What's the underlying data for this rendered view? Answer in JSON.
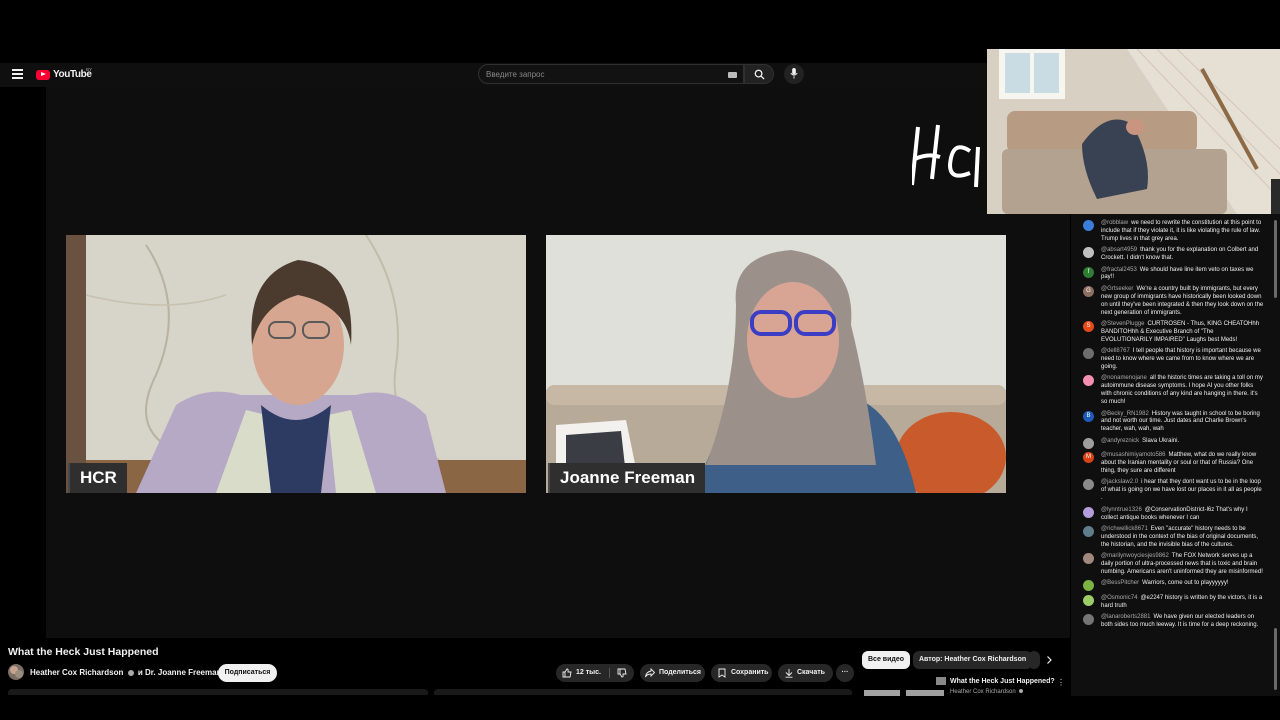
{
  "header": {
    "logo_text": "YouTube",
    "logo_country": "BY",
    "search_placeholder": "Введите запрос"
  },
  "player": {
    "logo_text": "HCR",
    "speakers": [
      {
        "name": "HCR"
      },
      {
        "name": "Joanne Freeman"
      }
    ]
  },
  "chat": {
    "messages": [
      {
        "author": "@robblaw",
        "text": "we need to rewrite the constitution at this point to include that if they violate it, it is like violating the rule of law. Trump lives in that grey area.",
        "color": "#3b7dd8",
        "initial": ""
      },
      {
        "author": "@absart4959",
        "text": "thank you for the explanation on Colbert and Crockett. I didn't know that.",
        "color": "#c0c0c0",
        "initial": ""
      },
      {
        "author": "@fractal2453",
        "text": "We should have line item veto on taxes we pay!!",
        "color": "#2e7d32",
        "initial": "f"
      },
      {
        "author": "@Grtseeker",
        "text": "We're a country built by immigrants, but every new group of immigrants have historically been looked down on until they've been integrated & then they look down on the next generation of immigrants.",
        "color": "#8d6e63",
        "initial": "G"
      },
      {
        "author": "@StevenPlugge",
        "text": "CURTROSEN - Thus, KING CHEATOHhh BANDITOHhh & Executive Branch of \"The EVOLUTIONARILY IMPAIRED\" Laughs best Meds!",
        "color": "#e64a19",
        "initial": "S"
      },
      {
        "author": "@dell8767",
        "text": "I tell people that history is important because we need to know where we came from to know where we are going.",
        "color": "#6d6d6d",
        "initial": ""
      },
      {
        "author": "@nonamenojane",
        "text": "all the historic times are taking a toll on my autoimmune disease symptoms. I hope AI you other folks with chronic conditions of any kind are hanging in there. it's so much!",
        "color": "#f48fb1",
        "initial": ""
      },
      {
        "author": "@Becky_RN1982",
        "text": "History was taught in school to be boring and not worth our time. Just dates and Charlie Brown's teacher, wah, wah, wah",
        "color": "#1e5bb8",
        "initial": "B"
      },
      {
        "author": "@andyreznick",
        "text": "Slava Ukraini.",
        "color": "#9e9e9e",
        "initial": ""
      },
      {
        "author": "@musashimiyamoto586",
        "text": "Matthew, what do we really know about the Iranian mentality or soul or that of Russia? One thing, they sure are different",
        "color": "#d84315",
        "initial": "M"
      },
      {
        "author": "@jackslaw2.0",
        "text": "i hear that they dont want us to be in the loop of what is going on we have lost our places in it all as people .",
        "color": "#8a8a8a",
        "initial": ""
      },
      {
        "author": "@lynntrue1326",
        "text": "@ConservationDistrict-l6z That's why I collect antique books whenever I can",
        "color": "#b39ddb",
        "initial": ""
      },
      {
        "author": "@richwellick8671",
        "text": "Even \"accurate\" history needs to be understood in the context of the bias of original documents, the historian, and the invisible bias of the cultures.",
        "color": "#607d8b",
        "initial": ""
      },
      {
        "author": "@marilynwoyciesjes9862",
        "text": "The FOX Network serves up a daily portion of ultra-processed news that is toxic and brain numbing. Americans aren't uninformed they are misinformed!",
        "color": "#a1887f",
        "initial": ""
      },
      {
        "author": "@BessPitcher",
        "text": "Warriors, come out to playyyyyy!",
        "color": "#7cb342",
        "initial": ""
      },
      {
        "author": "@Osmonic74",
        "text": "@e2247 history is written by the victors, it is a hard truth",
        "color": "#9ccc65",
        "initial": ""
      },
      {
        "author": "@lanaroberts2881",
        "text": "We have given our elected leaders on both sides too much leeway. It is time for a deep reckoning.",
        "color": "#757575",
        "initial": ""
      }
    ]
  },
  "video": {
    "title": "What the Heck Just Happened",
    "channel": "Heather Cox Richardson",
    "collab_connector": "и",
    "collaborator": "Dr. Joanne Freeman",
    "subscribe_label": "Подписаться",
    "like_count": "12 тыс.",
    "share_label": "Поделиться",
    "save_label": "Сохранить",
    "download_label": "Скачать",
    "more_label": "···"
  },
  "related": {
    "chips": [
      "Все видео",
      "Автор: Heather Cox Richardson"
    ],
    "item_title": "What the Heck Just Happened?",
    "item_channel": "Heather Cox Richardson",
    "item_more": "⋮"
  }
}
